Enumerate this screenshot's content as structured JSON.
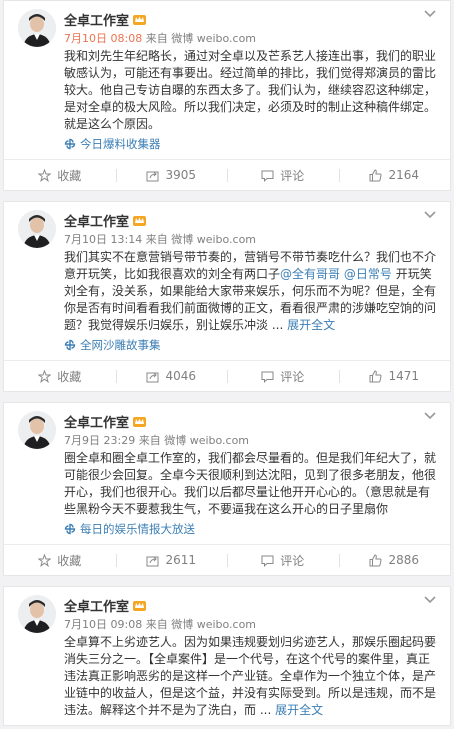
{
  "posts": [
    {
      "name": "全卓工作室",
      "time": "7月10日 08:08",
      "source": "来自 微博 weibo.com",
      "text": "我和刘先生年纪略长，通过对全卓以及芒系艺人接连出事，我们的职业敏感认为，可能还有事要出。经过简单的排比，我们觉得郑演员的雷比较大。他自己专访自曝的东西太多了。我们认为，继续容忍这种绑定，是对全卓的极大风险。所以我们决定，必须及时的制止这种稿件绑定。就是这么个原因。",
      "topic": "今日爆料收集器",
      "collect": "收藏",
      "share": "3905",
      "comment": "评论",
      "like": "2164"
    },
    {
      "name": "全卓工作室",
      "time": "7月10日 13:14",
      "source": "来自 微博 weibo.com",
      "text_before": "我们其实不在意营销号带节奏的，营销号不带节奏吃什么？我们也不介意开玩笑，比如我很喜欢的刘全有两口子",
      "mention1": "@全有哥哥",
      "mention2": "@日常号",
      "text_after": " 开玩笑刘全有，没关系，如果能给大家带来娱乐，何乐而不为呢？但是，全有你是否有时间看看我们前面微博的正文，看看很严肃的涉嫌吃空饷的问题？我觉得娱乐归娱乐，别让娱乐冲淡 ...",
      "expand": "展开全文",
      "topic": "全网沙雕故事集",
      "collect": "收藏",
      "share": "4046",
      "comment": "评论",
      "like": "1471"
    },
    {
      "name": "全卓工作室",
      "time": "7月9日 23:29",
      "source": "来自 微博 weibo.com",
      "text": "圈全卓和圈全卓工作室的，我们都会尽量看的。但是我们年纪大了，就可能很少会回复。全卓今天很顺利到达沈阳，见到了很多老朋友，他很开心，我们也很开心。我们以后都尽量让他开开心心的。（意思就是有些黑粉今天不要惹我生气，不要逼我在这么开心的日子里扇你",
      "topic": "每日的娱乐情报大放送",
      "collect": "收藏",
      "share": "2611",
      "comment": "评论",
      "like": "2886"
    },
    {
      "name": "全卓工作室",
      "time": "7月10日 09:08",
      "source": "来自 微博 weibo.com",
      "text_before": "全卓算不上劣迹艺人。因为如果违规要划归劣迹艺人，那娱乐圈起码要消失三分之一。【全卓案件】是一个代号，在这个代号的案件里，真正违法真正影响恶劣的是这样一个产业链。全卓作为一个独立个体，是产业链中的收益人，但是这个益，并没有实际受到。所以是违规，而不是违法。解释这个并不是为了洗白，而 ...",
      "expand": "展开全文"
    }
  ],
  "colors": {
    "accent": "#eb7350",
    "link": "#3d7fb5",
    "meta": "#808080",
    "background": "#f2f2f5"
  },
  "icons": {
    "avatar": "avatar-photo",
    "badge": "vip-crown-icon",
    "chevron": "chevron-down-icon",
    "topic": "topic-pinwheel-icon",
    "collect": "star-icon",
    "share": "share-icon",
    "comment": "comment-icon",
    "like": "thumb-up-icon"
  }
}
